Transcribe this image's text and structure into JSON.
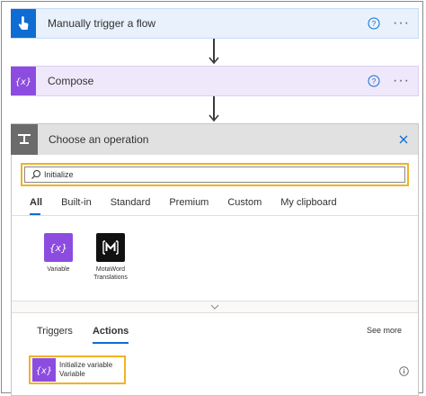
{
  "trigger_card": {
    "title": "Manually trigger a flow"
  },
  "compose_card": {
    "title": "Compose"
  },
  "operation_panel": {
    "title": "Choose an operation",
    "search": {
      "value": "Initialize"
    },
    "tabs": [
      {
        "label": "All",
        "active": true
      },
      {
        "label": "Built-in"
      },
      {
        "label": "Standard"
      },
      {
        "label": "Premium"
      },
      {
        "label": "Custom"
      },
      {
        "label": "My clipboard"
      }
    ],
    "connectors": [
      {
        "label": "Variable",
        "icon": "variable-icon",
        "color": "#8d4ce0"
      },
      {
        "label": "MotaWord Translations",
        "icon": "motaword-icon",
        "color": "#111111"
      }
    ],
    "sub_tabs": [
      {
        "label": "Triggers"
      },
      {
        "label": "Actions",
        "active": true
      }
    ],
    "see_more": "See more",
    "action": {
      "title": "Initialize variable",
      "subtitle": "Variable"
    }
  },
  "colors": {
    "trigger_accent": "#0f6cd3",
    "compose_accent": "#8d4ce0",
    "highlight": "#f0b323",
    "tab_underline": "#0f6cd3"
  }
}
